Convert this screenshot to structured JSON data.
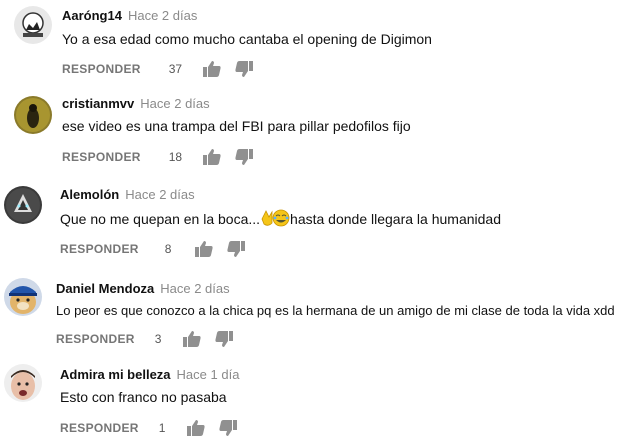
{
  "comments": [
    {
      "author": "Aaróng14",
      "time": "Hace 2 días",
      "text": "Yo a esa edad como mucho cantaba el opening de Digimon",
      "reply": "RESPONDER",
      "likes": "37",
      "avatar": "avatar-aarong14"
    },
    {
      "author": "cristianmvv",
      "time": "Hace 2 días",
      "text": "ese video es una trampa del FBI para pillar pedofilos fijo",
      "reply": "RESPONDER",
      "likes": "18",
      "avatar": "avatar-cristianmvv"
    },
    {
      "author": "Alemolón",
      "time": "Hace 2 días",
      "text_before": "Que no me quepan en la boca...",
      "text_after": "hasta donde llegara la humanidad",
      "emoji": "clap-laugh-emoji",
      "reply": "RESPONDER",
      "likes": "8",
      "avatar": "avatar-alemolon"
    },
    {
      "author": "Daniel Mendoza",
      "time": "Hace 2 días",
      "text": "Lo peor es que conozco a la chica pq es la hermana de un amigo de mi clase de toda la vida xdd",
      "reply": "RESPONDER",
      "likes": "3",
      "avatar": "avatar-daniel-mendoza"
    },
    {
      "author": "Admira mi belleza",
      "time": "Hace 1 día",
      "text": "Esto con franco no pasaba",
      "reply": "RESPONDER",
      "likes": "1",
      "avatar": "avatar-admira-mi-belleza"
    }
  ],
  "icons": {
    "like": "thumbs-up-icon",
    "dislike": "thumbs-down-icon"
  },
  "colors": {
    "author": "#111111",
    "meta": "#8a8a8a",
    "action": "#767676"
  }
}
